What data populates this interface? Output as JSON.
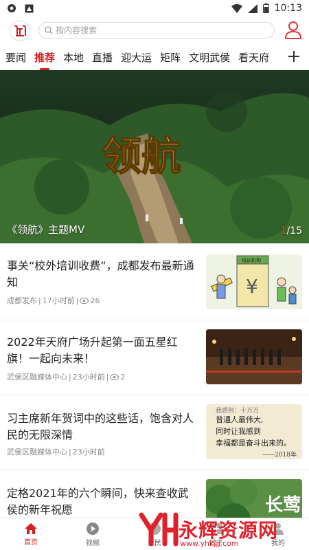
{
  "status": {
    "time": "10:13"
  },
  "search": {
    "placeholder": "按内容搜索"
  },
  "tabs": [
    {
      "label": "要闻"
    },
    {
      "label": "推荐",
      "active": true
    },
    {
      "label": "本地"
    },
    {
      "label": "直播"
    },
    {
      "label": "迎大运"
    },
    {
      "label": "矩阵"
    },
    {
      "label": "文明武侯"
    },
    {
      "label": "看天府"
    }
  ],
  "banner": {
    "caption": "《领航》主题MV",
    "current": "1",
    "total": "/15",
    "title_art": "领航"
  },
  "news": [
    {
      "title": "事关“校外培训收费”，成都发布最新通知",
      "source": "成都发布",
      "time": "17小时前",
      "views": "26",
      "thumb": "cartoon-illustration",
      "thumb_text": "培训机构"
    },
    {
      "title": "2022年天府广场升起第一面五星红旗！一起向未来！",
      "source": "武侯区融媒体中心",
      "time": "23小时前",
      "views": "2",
      "thumb": "flag-guards-photo"
    },
    {
      "title": "习主席新年贺词中的这些话，饱含对人民的无限深情",
      "source": "武侯区融媒体中心",
      "time": "23小时前",
      "thumb": "calligraphy-quote",
      "quote": [
        "普通人最伟大,",
        "同时让我感到",
        "幸福都是奋斗出来的。"
      ],
      "quote_year": "——2018年",
      "quote_top": "我感到：十万万"
    },
    {
      "title": "定格2021年的六个瞬间，快来查收武侯的新年祝愿",
      "thumb": "forest-new-year",
      "thumb_text": "长莺"
    }
  ],
  "bottomnav": [
    {
      "label": "首页",
      "icon": "home-icon",
      "active": true
    },
    {
      "label": "视频",
      "icon": "play-icon"
    },
    {
      "label": "武民",
      "icon": "service-icon"
    },
    {
      "label": "武子",
      "icon": "grid-icon"
    },
    {
      "label": "我的",
      "icon": "user-icon"
    }
  ],
  "watermark": {
    "text": "永辉资源网",
    "sub": "www.yhkjjj.com"
  },
  "colors": {
    "accent": "#d61f1f"
  }
}
